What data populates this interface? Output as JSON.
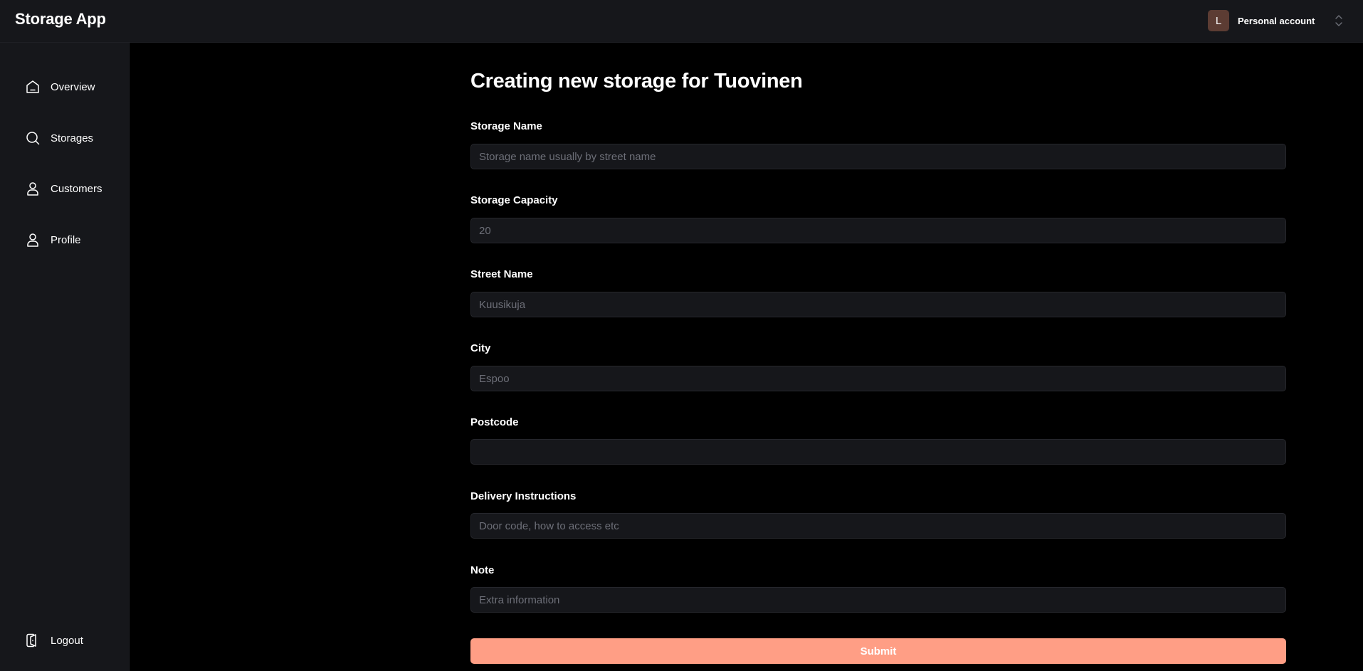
{
  "header": {
    "app_title": "Storage App",
    "account": {
      "avatar_letter": "L",
      "label": "Personal account",
      "avatar_color": "#5c3c33"
    }
  },
  "sidebar": {
    "items": [
      {
        "label": "Overview",
        "icon": "home-icon"
      },
      {
        "label": "Storages",
        "icon": "search-icon"
      },
      {
        "label": "Customers",
        "icon": "user-icon"
      },
      {
        "label": "Profile",
        "icon": "user-icon"
      }
    ],
    "logout": {
      "label": "Logout",
      "icon": "logout-icon"
    }
  },
  "form": {
    "title": "Creating new storage for Tuovinen",
    "fields": [
      {
        "label": "Storage Name",
        "placeholder": "Storage name usually by street name",
        "value": ""
      },
      {
        "label": "Storage Capacity",
        "placeholder": "20",
        "value": ""
      },
      {
        "label": "Street Name",
        "placeholder": "Kuusikuja",
        "value": ""
      },
      {
        "label": "City",
        "placeholder": "Espoo",
        "value": ""
      },
      {
        "label": "Postcode",
        "placeholder": "",
        "value": ""
      },
      {
        "label": "Delivery Instructions",
        "placeholder": "Door code, how to access etc",
        "value": ""
      },
      {
        "label": "Note",
        "placeholder": "Extra information",
        "value": ""
      }
    ],
    "submit_label": "Submit"
  },
  "colors": {
    "accent": "#ff9e85",
    "panel": "#16171b",
    "background": "#000000"
  }
}
